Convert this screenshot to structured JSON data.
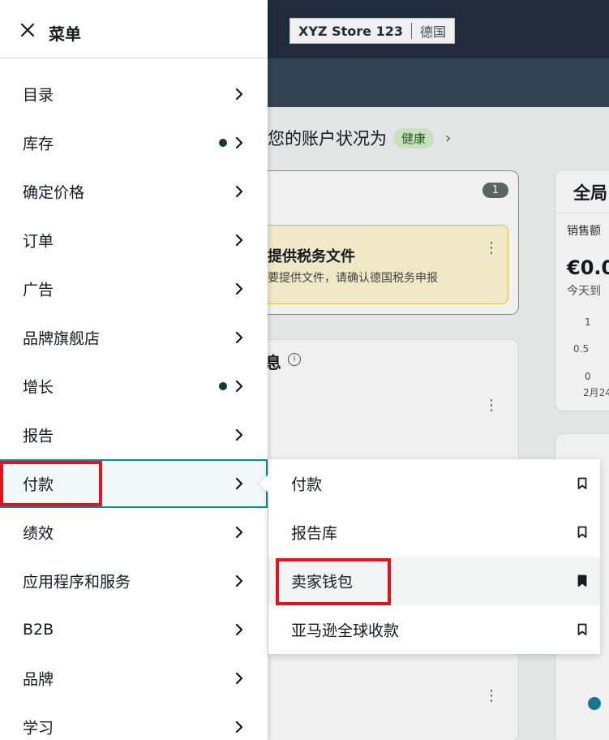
{
  "background": {
    "store_name": "XYZ Store 123",
    "store_country": "德国",
    "health_text": "您的账户状况为",
    "health_badge": "健康",
    "tax_count": "1",
    "tax_title": "提供税务文件",
    "tax_text": "要提供文件，请确认德国税务申报",
    "news_title": "息",
    "global_title": "全局",
    "sales_label": "销售额",
    "sales_amount": "€0.0",
    "sales_sub": "今天到",
    "y_ticks": [
      "1",
      "0.5",
      "0"
    ],
    "x_tick": "2月24"
  },
  "menu": {
    "title": "菜单",
    "items": [
      {
        "label": "目录",
        "dot": false
      },
      {
        "label": "库存",
        "dot": true
      },
      {
        "label": "确定价格",
        "dot": false
      },
      {
        "label": "订单",
        "dot": false
      },
      {
        "label": "广告",
        "dot": false
      },
      {
        "label": "品牌旗舰店",
        "dot": false
      },
      {
        "label": "增长",
        "dot": true
      },
      {
        "label": "报告",
        "dot": false
      },
      {
        "label": "付款",
        "dot": false,
        "active": true
      },
      {
        "label": "绩效",
        "dot": false
      },
      {
        "label": "应用程序和服务",
        "dot": false
      },
      {
        "label": "B2B",
        "dot": false
      },
      {
        "label": "品牌",
        "dot": false
      },
      {
        "label": "学习",
        "dot": false
      }
    ]
  },
  "submenu": {
    "items": [
      {
        "label": "付款",
        "bookmarked": false
      },
      {
        "label": "报告库",
        "bookmarked": false
      },
      {
        "label": "卖家钱包",
        "bookmarked": true,
        "hover": true
      },
      {
        "label": "亚马逊全球收款",
        "bookmarked": false
      }
    ]
  },
  "colors": {
    "active_border": "#138a93",
    "highlight_red": "#e0141e",
    "dot": "#0f3a3f",
    "topbar": "#232f3e"
  }
}
